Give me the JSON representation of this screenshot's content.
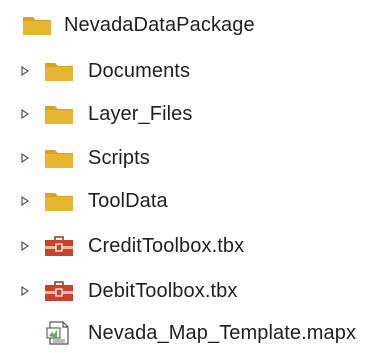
{
  "tree": {
    "root": {
      "label": "NevadaDataPackage",
      "icon": "folder-icon"
    },
    "items": [
      {
        "label": "Documents",
        "icon": "folder-icon",
        "expandable": true
      },
      {
        "label": "Layer_Files",
        "icon": "folder-icon",
        "expandable": true
      },
      {
        "label": "Scripts",
        "icon": "folder-icon",
        "expandable": true
      },
      {
        "label": "ToolData",
        "icon": "folder-icon",
        "expandable": true
      },
      {
        "label": "CreditToolbox.tbx",
        "icon": "toolbox-icon",
        "expandable": true
      },
      {
        "label": "DebitToolbox.tbx",
        "icon": "toolbox-icon",
        "expandable": true
      },
      {
        "label": "Nevada_Map_Template.mapx",
        "icon": "map-document-icon",
        "expandable": false
      }
    ]
  },
  "colors": {
    "folder_body": "#e8b530",
    "folder_tab": "#d9a21f",
    "toolbox_body": "#c9432c",
    "toolbox_band": "#e8b8a8",
    "expander_stroke": "#555555",
    "text": "#1f1f1f"
  }
}
